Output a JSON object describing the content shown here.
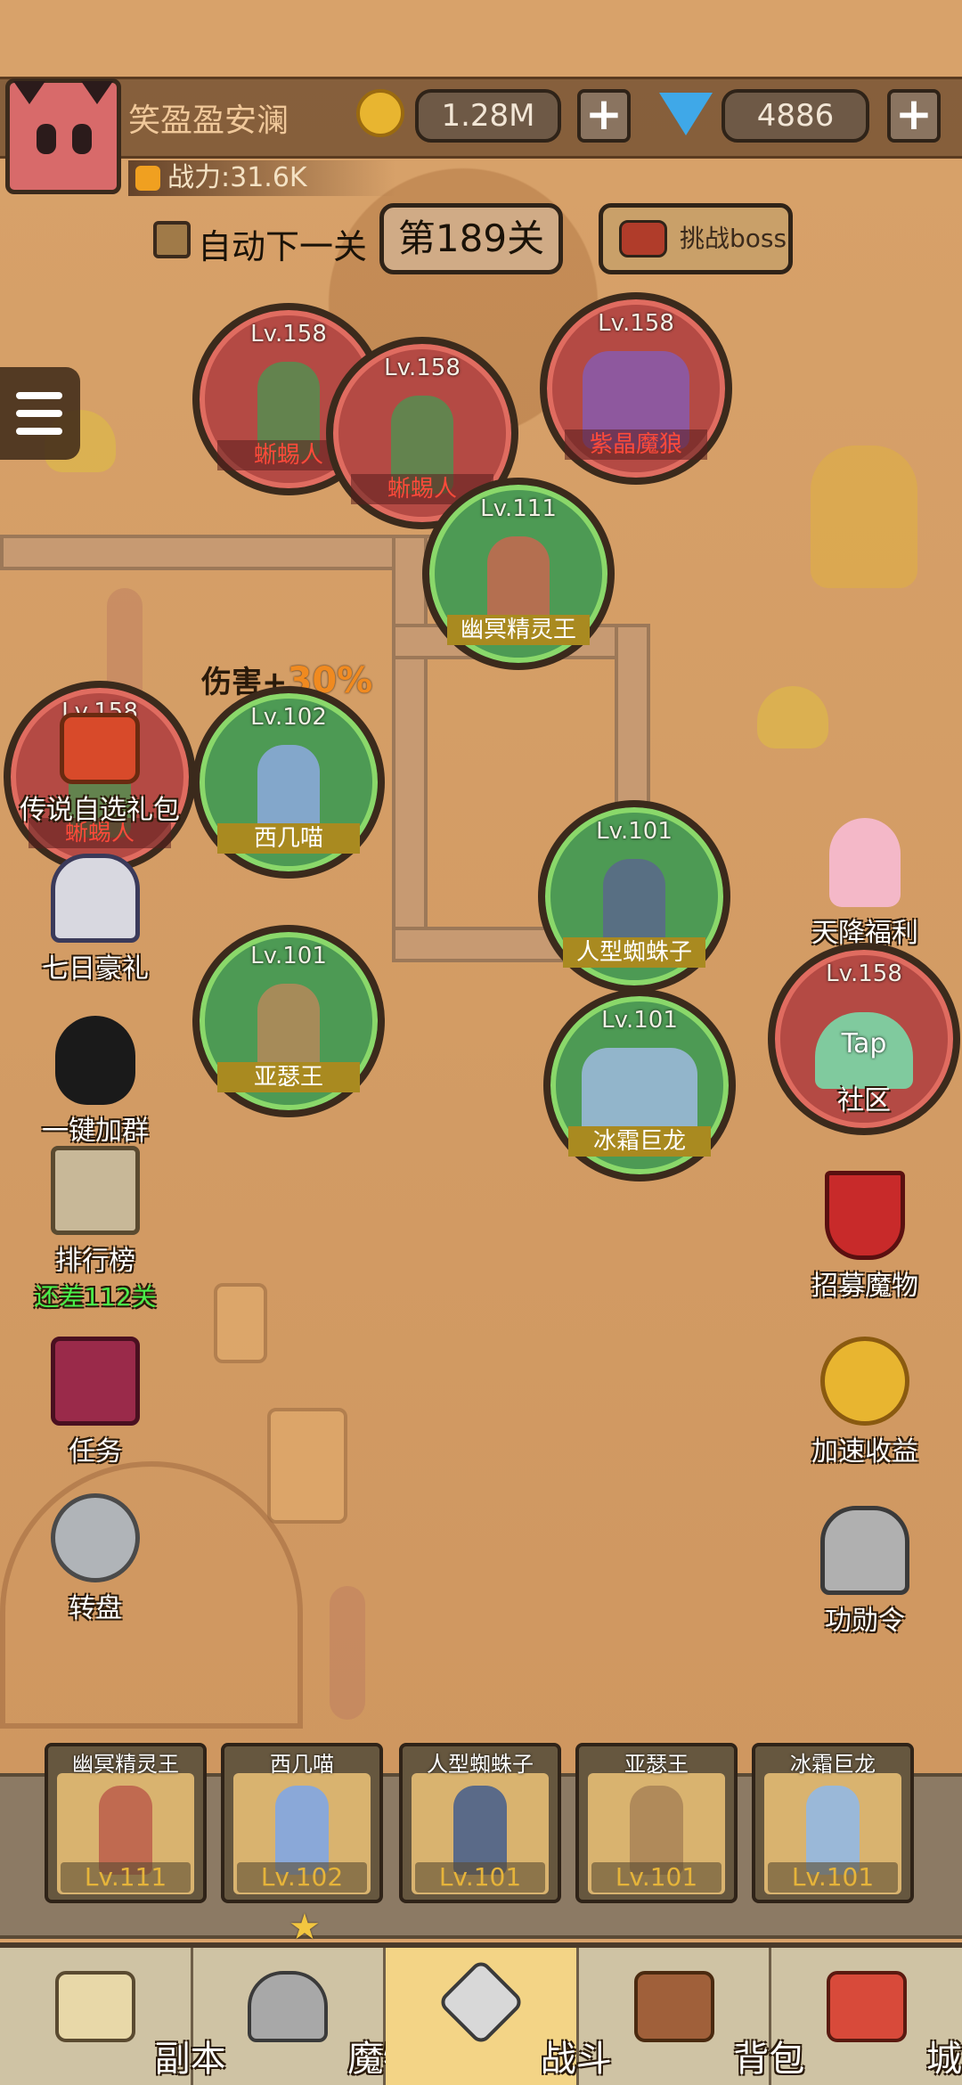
{
  "player": {
    "name": "笑盈盈安澜",
    "power": "战力:31.6K"
  },
  "currency": {
    "gold": "1.28M",
    "gems": "4886",
    "plus": "+"
  },
  "stage": {
    "auto_next_label": "自动下一关",
    "stage_label": "第189关",
    "boss_button": "挑战boss"
  },
  "buff": {
    "label": "伤害+",
    "value": "30%"
  },
  "enemies": [
    {
      "level": "Lv.158",
      "name": "蜥蜴人"
    },
    {
      "level": "Lv.158",
      "name": "蜥蜴人"
    },
    {
      "level": "Lv.158",
      "name": "紫晶魔狼"
    },
    {
      "level": "Lv.158",
      "name": "蜥蜴人"
    }
  ],
  "allies": [
    {
      "level": "Lv.111",
      "name": "幽冥精灵王"
    },
    {
      "level": "Lv.102",
      "name": "西几喵"
    },
    {
      "level": "Lv.101",
      "name": "人型蜘蛛子"
    },
    {
      "level": "Lv.101",
      "name": "亚瑟王"
    },
    {
      "level": "Lv.101",
      "name": "冰霜巨龙"
    }
  ],
  "left_menu": [
    {
      "label": "传说自选礼包"
    },
    {
      "label": "七日豪礼"
    },
    {
      "label": "一键加群"
    },
    {
      "label": "排行榜",
      "sub": "还差112关"
    },
    {
      "label": "任务"
    },
    {
      "label": "转盘"
    }
  ],
  "right_menu": [
    {
      "label": "天降福利"
    },
    {
      "label": "社区"
    },
    {
      "label": "招募魔物"
    },
    {
      "label": "加速收益"
    },
    {
      "label": "功勋令"
    }
  ],
  "tap_label": "Tap",
  "team": [
    {
      "name": "幽冥精灵王",
      "level": "Lv.111"
    },
    {
      "name": "西几喵",
      "level": "Lv.102"
    },
    {
      "name": "人型蜘蛛子",
      "level": "Lv.101"
    },
    {
      "name": "亚瑟王",
      "level": "Lv.101"
    },
    {
      "name": "冰霜巨龙",
      "level": "Lv.101"
    }
  ],
  "nav": [
    {
      "label": "副本"
    },
    {
      "label": "魔物"
    },
    {
      "label": "战斗"
    },
    {
      "label": "背包"
    },
    {
      "label": "城镇"
    }
  ],
  "colors": {
    "enemy_ring": "#b44a44",
    "ally_ring": "#4d9a54",
    "nav_active": "#f3d486",
    "sub_text": "#4aef4a"
  }
}
